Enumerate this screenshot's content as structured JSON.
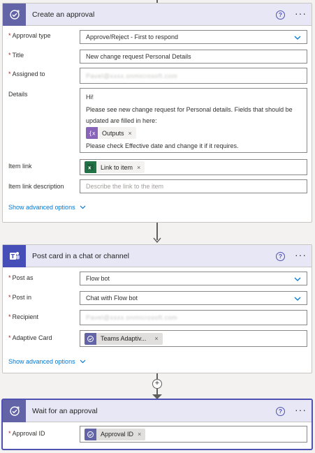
{
  "approval": {
    "title": "Create an approval",
    "help": "?",
    "more": "···",
    "approval_type_label": "Approval type",
    "approval_type_value": "Approve/Reject - First to respond",
    "title_label": "Title",
    "title_value": "New change request Personal Details",
    "assigned_label": "Assigned to",
    "assigned_value": "Pavel@xxxx.onmicrosoft.com",
    "details_label": "Details",
    "details_line1": "Hi!",
    "details_line2": "Please see new change request for Personal details. Fields that should be",
    "details_line3": "updated are filled in here:",
    "outputs_token": "Outputs",
    "details_line4": "Please check Effective date and change it if it requires.",
    "item_link_label": "Item link",
    "item_link_token": "Link to item",
    "item_link_desc_label": "Item link description",
    "item_link_desc_placeholder": "Describe the link to the item",
    "advanced": "Show advanced options"
  },
  "teams": {
    "title": "Post card in a chat or channel",
    "help": "?",
    "more": "···",
    "post_as_label": "Post as",
    "post_as_value": "Flow bot",
    "post_in_label": "Post in",
    "post_in_value": "Chat with Flow bot",
    "recipient_label": "Recipient",
    "recipient_value": "Pavel@xxxx.onmicrosoft.com",
    "card_label": "Adaptive Card",
    "card_token": "Teams Adaptiv...",
    "advanced": "Show advanced options"
  },
  "wait": {
    "title": "Wait for an approval",
    "help": "?",
    "more": "···",
    "approval_id_label": "Approval ID",
    "approval_id_token": "Approval ID"
  },
  "token_x": "×",
  "required_mark": "*",
  "plus": "+",
  "colors": {
    "approval_brand": "#6264a7",
    "teams_brand": "#464eb8",
    "link": "#0078d4",
    "required": "#a4262c",
    "expression_token": "#8764b8",
    "excel_token": "#217346"
  }
}
